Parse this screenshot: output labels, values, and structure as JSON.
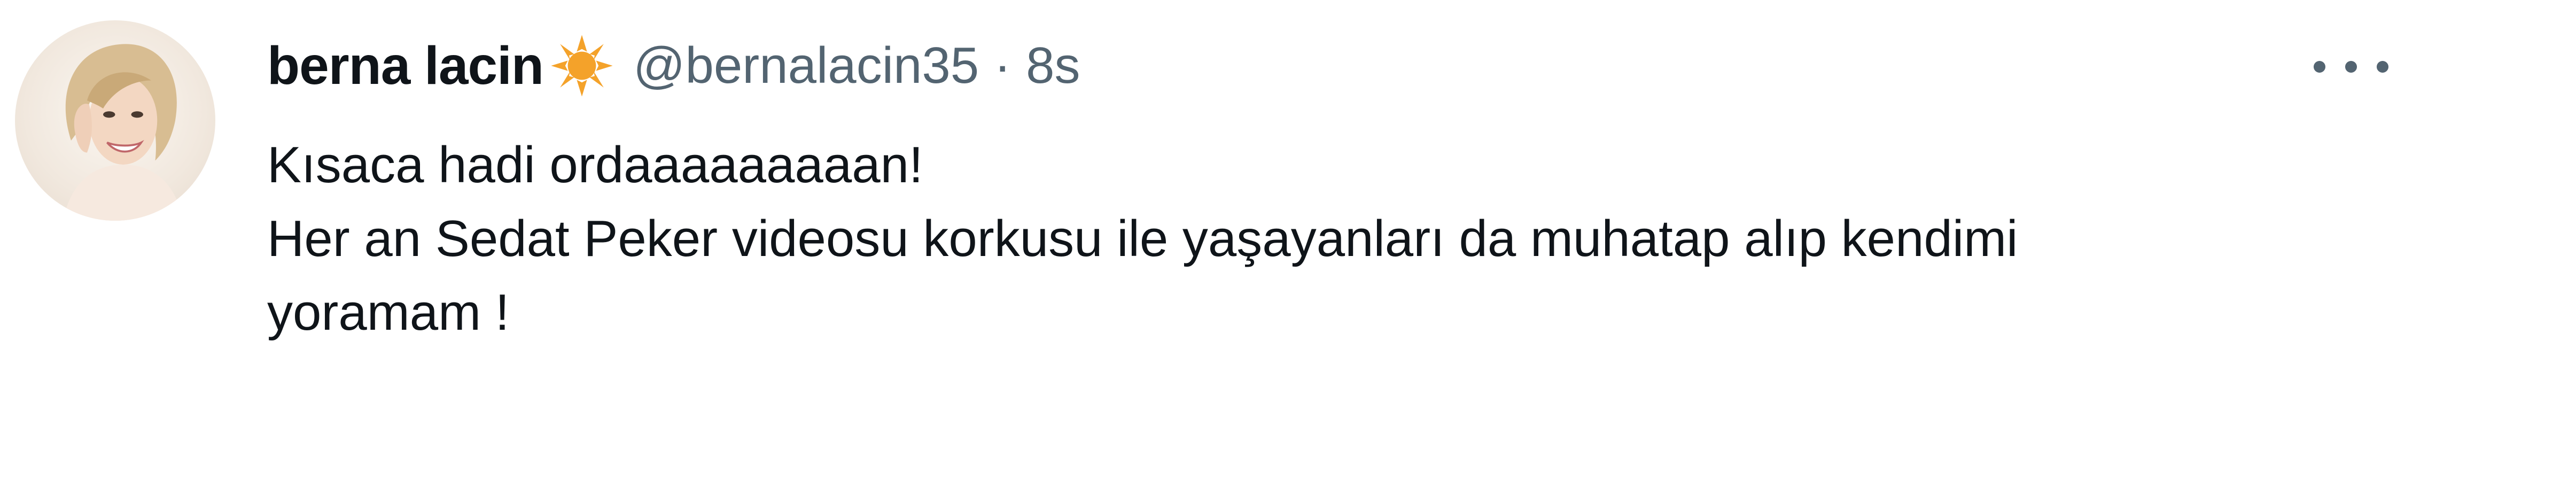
{
  "tweet": {
    "display_name": "berna lacin",
    "handle": "@bernalacin35",
    "separator": "·",
    "time": "8s",
    "verified_badge_icon": "sun-badge-icon",
    "more_icon": "ellipsis-icon",
    "text_lines": [
      "Kısaca hadi ordaaaaaaaaan!",
      "Her an Sedat Peker videosu korkusu ile yaşayanları da muhatap alıp kendimi",
      "yoramam !"
    ]
  },
  "colors": {
    "text": "#0f1419",
    "secondary": "#536471",
    "badge": "#f4a22a",
    "background": "#ffffff"
  }
}
